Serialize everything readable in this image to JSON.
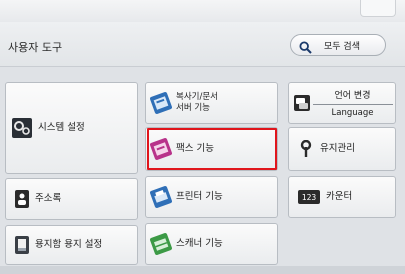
{
  "header": {
    "title": "사용자 도구",
    "search_label": "모두 검색"
  },
  "tiles": {
    "system_settings": "시스템 설정",
    "copy_doc_server_line1": "복사기/문서",
    "copy_doc_server_line2": "서버 기능",
    "fax": "팩스 기능",
    "address_book": "주소록",
    "printer": "프린터 기능",
    "paper_tray": "용지함 용지 설정",
    "scanner": "스캐너 기능",
    "language_change": "언어 변경",
    "language": "Language",
    "maintenance": "유지관리",
    "counter": "카운터",
    "counter_icon_text": "123"
  },
  "colors": {
    "highlight": "#e0151c",
    "background": "#dfe2e6"
  }
}
